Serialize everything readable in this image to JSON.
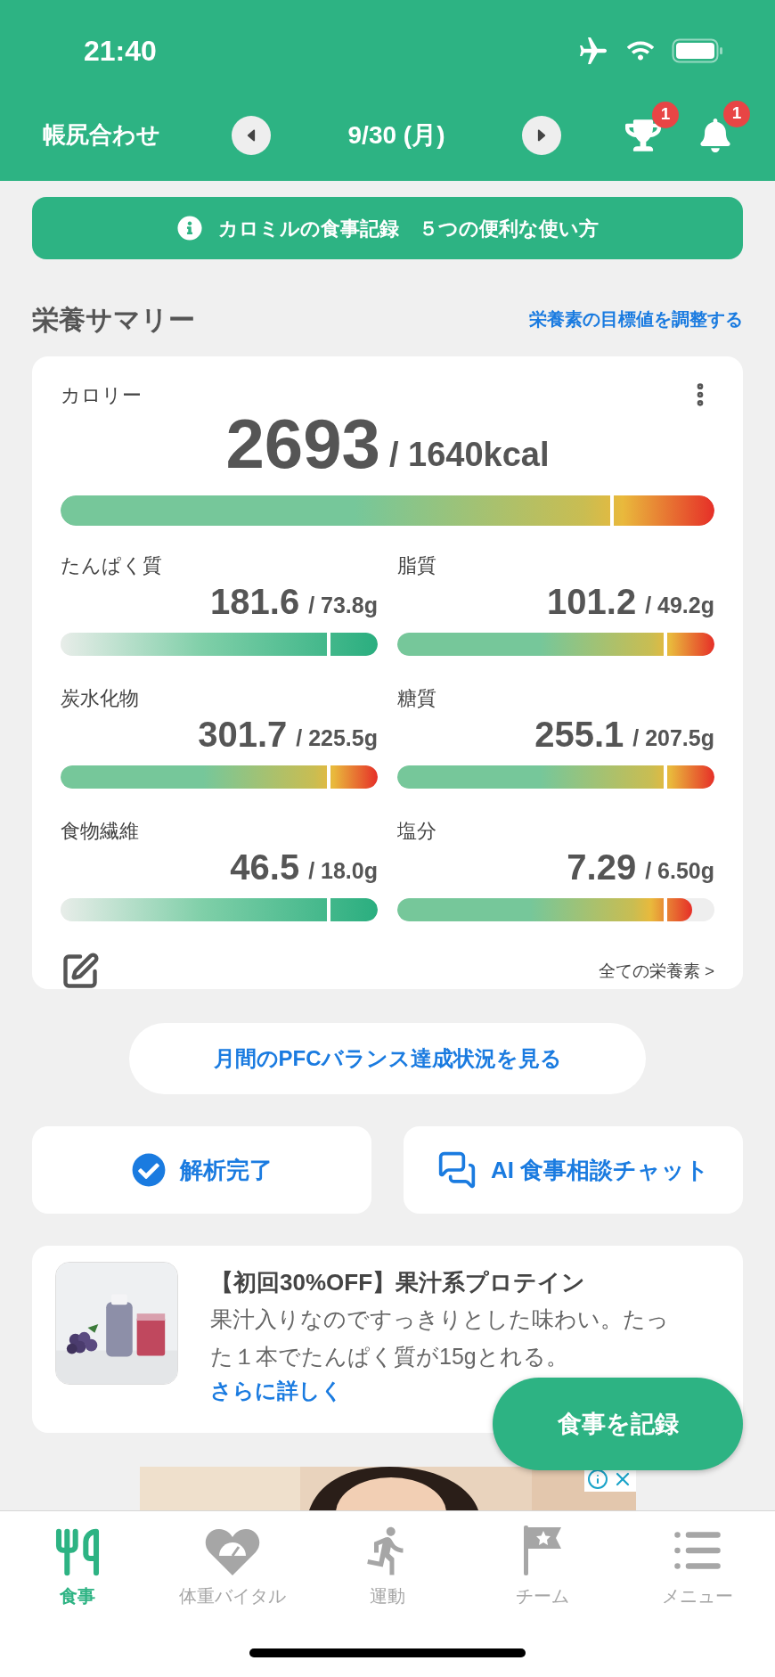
{
  "status_bar": {
    "time": "21:40"
  },
  "header": {
    "title": "帳尻合わせ",
    "date": "9/30 (月)",
    "trophy_badge": "1",
    "bell_badge": "1"
  },
  "banner": {
    "text": "カロミルの食事記録　５つの便利な使い方"
  },
  "summary": {
    "title": "栄養サマリー",
    "link": "栄養素の目標値を調整する",
    "calorie": {
      "label": "カロリー",
      "value": "2693",
      "target": "/ 1640kcal",
      "level": 1,
      "kind": "over"
    },
    "nutrients": [
      {
        "label": "たんぱく質",
        "value": "181.6",
        "target": "/ 73.8g",
        "level": 1,
        "kind": "green"
      },
      {
        "label": "脂質",
        "value": "101.2",
        "target": "/ 49.2g",
        "level": 1,
        "kind": "over"
      },
      {
        "label": "炭水化物",
        "value": "301.7",
        "target": "/ 225.5g",
        "level": 1,
        "kind": "over"
      },
      {
        "label": "糖質",
        "value": "255.1",
        "target": "/ 207.5g",
        "level": 1,
        "kind": "over"
      },
      {
        "label": "食物繊維",
        "value": "46.5",
        "target": "/ 18.0g",
        "level": 1,
        "kind": "green"
      },
      {
        "label": "塩分",
        "value": "7.29",
        "target": "/ 6.50g",
        "level": 0.93,
        "kind": "over"
      }
    ],
    "all_link": "全ての栄養素 >"
  },
  "pfc_button": "月間のPFCバランス達成状況を見る",
  "actions": [
    {
      "label": "解析完了",
      "kind": "status"
    },
    {
      "label": "AI 食事相談チャット",
      "kind": "chat"
    }
  ],
  "ad": {
    "title": "【初回30%OFF】果汁系プロテイン",
    "body": "果汁入りなのですっきりとした味わい。たった１本でたんぱく質が15gとれる。",
    "link": "さらに詳しく"
  },
  "fab": "食事を記録",
  "tabs": [
    {
      "label": "食事",
      "kind": "meal",
      "selected": true
    },
    {
      "label": "体重バイタル",
      "kind": "weight",
      "selected": false
    },
    {
      "label": "運動",
      "kind": "exercise",
      "selected": false
    },
    {
      "label": "チーム",
      "kind": "team",
      "selected": false
    },
    {
      "label": "メニュー",
      "kind": "menu",
      "selected": false
    }
  ]
}
